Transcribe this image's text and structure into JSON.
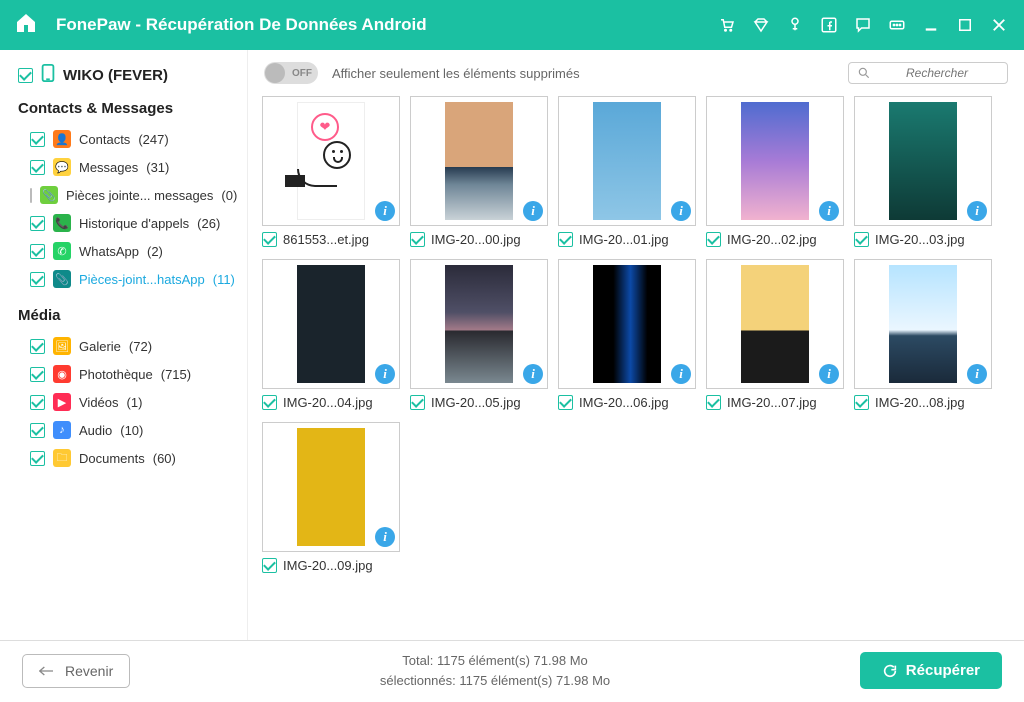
{
  "titlebar": {
    "title": "FonePaw - Récupération De Données Android"
  },
  "sidebar": {
    "device": "WIKO (FEVER)",
    "section1": "Contacts & Messages",
    "section2": "Média",
    "cats": [
      {
        "label": "Contacts",
        "count": "(247)"
      },
      {
        "label": "Messages",
        "count": "(31)"
      },
      {
        "label": "Pièces jointe... messages",
        "count": "(0)"
      },
      {
        "label": "Historique d'appels",
        "count": "(26)"
      },
      {
        "label": "WhatsApp",
        "count": "(2)"
      },
      {
        "label": "Pièces-joint...hatsApp",
        "count": "(11)"
      },
      {
        "label": "Galerie",
        "count": "(72)"
      },
      {
        "label": "Photothèque",
        "count": "(715)"
      },
      {
        "label": "Vidéos",
        "count": "(1)"
      },
      {
        "label": "Audio",
        "count": "(10)"
      },
      {
        "label": "Documents",
        "count": "(60)"
      }
    ]
  },
  "filter": {
    "toggle_label": "OFF",
    "text": "Afficher seulement les éléments supprimés"
  },
  "search": {
    "placeholder": "Rechercher"
  },
  "grid": {
    "files": [
      {
        "name": "861553...et.jpg"
      },
      {
        "name": "IMG-20...00.jpg"
      },
      {
        "name": "IMG-20...01.jpg"
      },
      {
        "name": "IMG-20...02.jpg"
      },
      {
        "name": "IMG-20...03.jpg"
      },
      {
        "name": "IMG-20...04.jpg"
      },
      {
        "name": "IMG-20...05.jpg"
      },
      {
        "name": "IMG-20...06.jpg"
      },
      {
        "name": "IMG-20...07.jpg"
      },
      {
        "name": "IMG-20...08.jpg"
      },
      {
        "name": "IMG-20...09.jpg"
      }
    ]
  },
  "footer": {
    "back": "Revenir",
    "line1": "Total: 1175 élément(s) 71.98 Mo",
    "line2": "sélectionnés: 1175 élément(s) 71.98 Mo",
    "recover": "Récupérer"
  }
}
